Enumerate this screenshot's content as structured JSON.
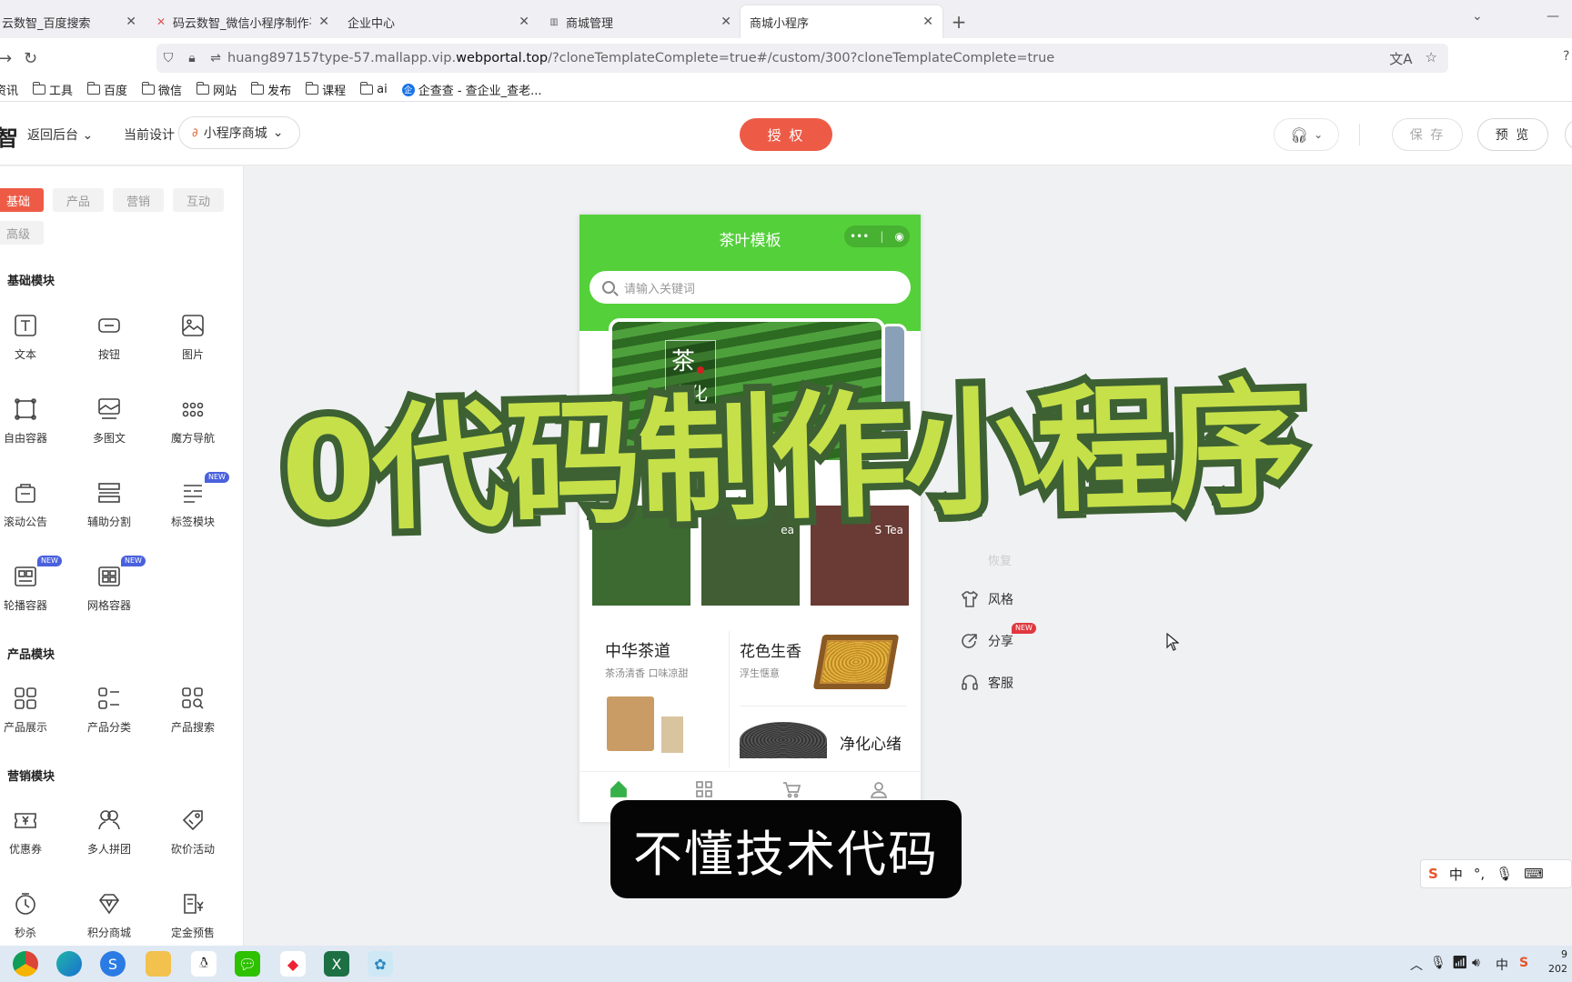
{
  "browser": {
    "tabs": [
      {
        "label": "云数智_百度搜索",
        "fav": "search-icon"
      },
      {
        "label": "码云数智_微信小程序制作平台_",
        "fav": "x-logo-icon"
      },
      {
        "label": "企业中心",
        "fav": ""
      },
      {
        "label": "商城管理",
        "fav": "bars-icon"
      },
      {
        "label": "商城小程序",
        "fav": ""
      }
    ],
    "url_prefix": "huang897157type-57.mallapp.vip.",
    "url_domain": "webportal.top",
    "url_suffix": "/?cloneTemplateComplete=true#/custom/300?cloneTemplateComplete=true",
    "bookmarks": [
      "资讯",
      "工具",
      "百度",
      "微信",
      "网站",
      "发布",
      "课程",
      "ai",
      "企查查 - 查企业_查老..."
    ]
  },
  "header": {
    "logo": "智",
    "back_label": "返回后台",
    "current_design_label": "当前设计",
    "design_select": "小程序商城",
    "auth_button": "授 权",
    "save_button": "保 存",
    "preview_button": "预 览"
  },
  "left_panel": {
    "tabs": [
      "基础",
      "产品",
      "营销",
      "互动",
      "高级"
    ],
    "active_tab": "基础",
    "sections": [
      {
        "title": "基础模块",
        "items": [
          {
            "label": "文本",
            "icon": "text-icon"
          },
          {
            "label": "按钮",
            "icon": "button-icon"
          },
          {
            "label": "图片",
            "icon": "image-icon"
          },
          {
            "label": "自由容器",
            "icon": "free-container-icon"
          },
          {
            "label": "多图文",
            "icon": "multi-image-icon"
          },
          {
            "label": "魔方导航",
            "icon": "grid-dots-icon"
          },
          {
            "label": "滚动公告",
            "icon": "notice-icon"
          },
          {
            "label": "辅助分割",
            "icon": "divider-icon"
          },
          {
            "label": "标签模块",
            "icon": "tag-module-icon",
            "badge": "NEW"
          },
          {
            "label": "轮播容器",
            "icon": "carousel-icon",
            "badge": "NEW"
          },
          {
            "label": "网格容器",
            "icon": "grid-container-icon",
            "badge": "NEW"
          }
        ]
      },
      {
        "title": "产品模块",
        "items": [
          {
            "label": "产品展示",
            "icon": "product-display-icon"
          },
          {
            "label": "产品分类",
            "icon": "product-category-icon"
          },
          {
            "label": "产品搜索",
            "icon": "product-search-icon"
          }
        ]
      },
      {
        "title": "营销模块",
        "items": [
          {
            "label": "优惠券",
            "icon": "coupon-icon"
          },
          {
            "label": "多人拼团",
            "icon": "group-buy-icon"
          },
          {
            "label": "砍价活动",
            "icon": "bargain-icon"
          },
          {
            "label": "秒杀",
            "icon": "flash-sale-icon"
          },
          {
            "label": "积分商城",
            "icon": "points-mall-icon"
          },
          {
            "label": "定金预售",
            "icon": "presale-icon"
          }
        ]
      }
    ]
  },
  "phone": {
    "title": "茶叶模板",
    "capsule_dots": "•••",
    "search_placeholder": "请输入关键词",
    "banner_text_1": "茶",
    "banner_text_2": "文化",
    "thumb_labels": [
      "",
      "ea",
      "S    Tea"
    ],
    "products": [
      {
        "name": "中华茶道",
        "desc": "茶汤清香 口味凉甜"
      },
      {
        "name": "花色生香",
        "desc": "浮生惬意"
      },
      {
        "name": "净化心绪",
        "desc": ""
      }
    ]
  },
  "settings_menu": {
    "restore": "恢复",
    "items": [
      {
        "label": "风格",
        "icon": "shirt-icon"
      },
      {
        "label": "分享",
        "icon": "share-icon",
        "badge": "NEW"
      },
      {
        "label": "客服",
        "icon": "headset-icon"
      }
    ]
  },
  "overlay": {
    "title": "0代码制作小程序",
    "caption": "不懂技术代码"
  },
  "ime": {
    "lang": "中",
    "items": [
      "°,",
      "mic",
      "kbd"
    ]
  },
  "clock": {
    "line1": "9",
    "line2": "202"
  },
  "colors": {
    "accent": "#ed5b46",
    "phone_green": "#54d03a",
    "title_fill": "#c6e04a",
    "title_stroke": "#3d6133"
  }
}
